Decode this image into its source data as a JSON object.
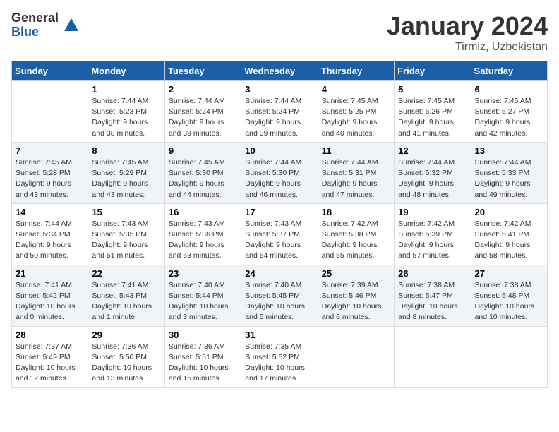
{
  "header": {
    "logo_general": "General",
    "logo_blue": "Blue",
    "month_title": "January 2024",
    "subtitle": "Tirmiz, Uzbekistan"
  },
  "weekdays": [
    "Sunday",
    "Monday",
    "Tuesday",
    "Wednesday",
    "Thursday",
    "Friday",
    "Saturday"
  ],
  "weeks": [
    [
      {
        "day": "",
        "sunrise": "",
        "sunset": "",
        "daylight": ""
      },
      {
        "day": "1",
        "sunrise": "Sunrise: 7:44 AM",
        "sunset": "Sunset: 5:23 PM",
        "daylight": "Daylight: 9 hours and 38 minutes."
      },
      {
        "day": "2",
        "sunrise": "Sunrise: 7:44 AM",
        "sunset": "Sunset: 5:24 PM",
        "daylight": "Daylight: 9 hours and 39 minutes."
      },
      {
        "day": "3",
        "sunrise": "Sunrise: 7:44 AM",
        "sunset": "Sunset: 5:24 PM",
        "daylight": "Daylight: 9 hours and 39 minutes."
      },
      {
        "day": "4",
        "sunrise": "Sunrise: 7:45 AM",
        "sunset": "Sunset: 5:25 PM",
        "daylight": "Daylight: 9 hours and 40 minutes."
      },
      {
        "day": "5",
        "sunrise": "Sunrise: 7:45 AM",
        "sunset": "Sunset: 5:26 PM",
        "daylight": "Daylight: 9 hours and 41 minutes."
      },
      {
        "day": "6",
        "sunrise": "Sunrise: 7:45 AM",
        "sunset": "Sunset: 5:27 PM",
        "daylight": "Daylight: 9 hours and 42 minutes."
      }
    ],
    [
      {
        "day": "7",
        "sunrise": "Sunrise: 7:45 AM",
        "sunset": "Sunset: 5:28 PM",
        "daylight": "Daylight: 9 hours and 43 minutes."
      },
      {
        "day": "8",
        "sunrise": "Sunrise: 7:45 AM",
        "sunset": "Sunset: 5:29 PM",
        "daylight": "Daylight: 9 hours and 43 minutes."
      },
      {
        "day": "9",
        "sunrise": "Sunrise: 7:45 AM",
        "sunset": "Sunset: 5:30 PM",
        "daylight": "Daylight: 9 hours and 44 minutes."
      },
      {
        "day": "10",
        "sunrise": "Sunrise: 7:44 AM",
        "sunset": "Sunset: 5:30 PM",
        "daylight": "Daylight: 9 hours and 46 minutes."
      },
      {
        "day": "11",
        "sunrise": "Sunrise: 7:44 AM",
        "sunset": "Sunset: 5:31 PM",
        "daylight": "Daylight: 9 hours and 47 minutes."
      },
      {
        "day": "12",
        "sunrise": "Sunrise: 7:44 AM",
        "sunset": "Sunset: 5:32 PM",
        "daylight": "Daylight: 9 hours and 48 minutes."
      },
      {
        "day": "13",
        "sunrise": "Sunrise: 7:44 AM",
        "sunset": "Sunset: 5:33 PM",
        "daylight": "Daylight: 9 hours and 49 minutes."
      }
    ],
    [
      {
        "day": "14",
        "sunrise": "Sunrise: 7:44 AM",
        "sunset": "Sunset: 5:34 PM",
        "daylight": "Daylight: 9 hours and 50 minutes."
      },
      {
        "day": "15",
        "sunrise": "Sunrise: 7:43 AM",
        "sunset": "Sunset: 5:35 PM",
        "daylight": "Daylight: 9 hours and 51 minutes."
      },
      {
        "day": "16",
        "sunrise": "Sunrise: 7:43 AM",
        "sunset": "Sunset: 5:36 PM",
        "daylight": "Daylight: 9 hours and 53 minutes."
      },
      {
        "day": "17",
        "sunrise": "Sunrise: 7:43 AM",
        "sunset": "Sunset: 5:37 PM",
        "daylight": "Daylight: 9 hours and 54 minutes."
      },
      {
        "day": "18",
        "sunrise": "Sunrise: 7:42 AM",
        "sunset": "Sunset: 5:38 PM",
        "daylight": "Daylight: 9 hours and 55 minutes."
      },
      {
        "day": "19",
        "sunrise": "Sunrise: 7:42 AM",
        "sunset": "Sunset: 5:39 PM",
        "daylight": "Daylight: 9 hours and 57 minutes."
      },
      {
        "day": "20",
        "sunrise": "Sunrise: 7:42 AM",
        "sunset": "Sunset: 5:41 PM",
        "daylight": "Daylight: 9 hours and 58 minutes."
      }
    ],
    [
      {
        "day": "21",
        "sunrise": "Sunrise: 7:41 AM",
        "sunset": "Sunset: 5:42 PM",
        "daylight": "Daylight: 10 hours and 0 minutes."
      },
      {
        "day": "22",
        "sunrise": "Sunrise: 7:41 AM",
        "sunset": "Sunset: 5:43 PM",
        "daylight": "Daylight: 10 hours and 1 minute."
      },
      {
        "day": "23",
        "sunrise": "Sunrise: 7:40 AM",
        "sunset": "Sunset: 5:44 PM",
        "daylight": "Daylight: 10 hours and 3 minutes."
      },
      {
        "day": "24",
        "sunrise": "Sunrise: 7:40 AM",
        "sunset": "Sunset: 5:45 PM",
        "daylight": "Daylight: 10 hours and 5 minutes."
      },
      {
        "day": "25",
        "sunrise": "Sunrise: 7:39 AM",
        "sunset": "Sunset: 5:46 PM",
        "daylight": "Daylight: 10 hours and 6 minutes."
      },
      {
        "day": "26",
        "sunrise": "Sunrise: 7:38 AM",
        "sunset": "Sunset: 5:47 PM",
        "daylight": "Daylight: 10 hours and 8 minutes."
      },
      {
        "day": "27",
        "sunrise": "Sunrise: 7:38 AM",
        "sunset": "Sunset: 5:48 PM",
        "daylight": "Daylight: 10 hours and 10 minutes."
      }
    ],
    [
      {
        "day": "28",
        "sunrise": "Sunrise: 7:37 AM",
        "sunset": "Sunset: 5:49 PM",
        "daylight": "Daylight: 10 hours and 12 minutes."
      },
      {
        "day": "29",
        "sunrise": "Sunrise: 7:36 AM",
        "sunset": "Sunset: 5:50 PM",
        "daylight": "Daylight: 10 hours and 13 minutes."
      },
      {
        "day": "30",
        "sunrise": "Sunrise: 7:36 AM",
        "sunset": "Sunset: 5:51 PM",
        "daylight": "Daylight: 10 hours and 15 minutes."
      },
      {
        "day": "31",
        "sunrise": "Sunrise: 7:35 AM",
        "sunset": "Sunset: 5:52 PM",
        "daylight": "Daylight: 10 hours and 17 minutes."
      },
      {
        "day": "",
        "sunrise": "",
        "sunset": "",
        "daylight": ""
      },
      {
        "day": "",
        "sunrise": "",
        "sunset": "",
        "daylight": ""
      },
      {
        "day": "",
        "sunrise": "",
        "sunset": "",
        "daylight": ""
      }
    ]
  ]
}
